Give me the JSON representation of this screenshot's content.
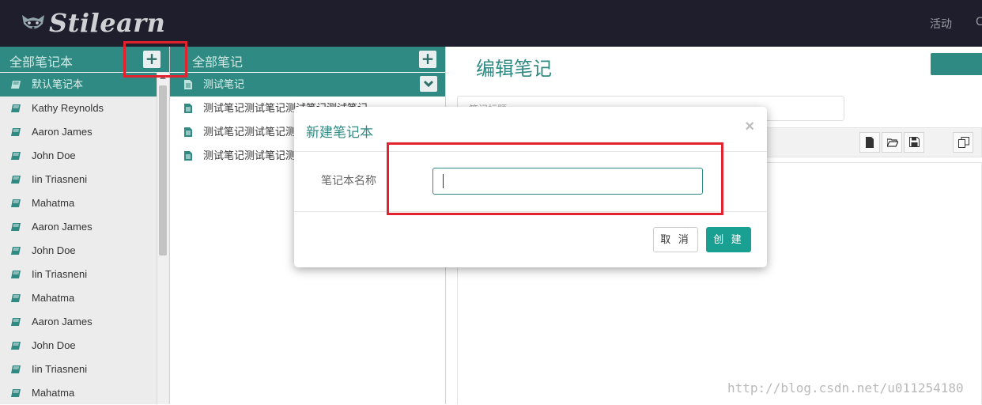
{
  "app": {
    "logo_text": "Stilearn",
    "nav_activity": "活动",
    "nav_edge": "C"
  },
  "notebooks": {
    "header_title": "全部笔记本",
    "add_label": "+",
    "items": [
      {
        "label": "默认笔记本",
        "active": true
      },
      {
        "label": "Kathy Reynolds"
      },
      {
        "label": "Aaron James"
      },
      {
        "label": "John Doe"
      },
      {
        "label": "Iin Triasneni"
      },
      {
        "label": "Mahatma"
      },
      {
        "label": "Aaron James"
      },
      {
        "label": "John Doe"
      },
      {
        "label": "Iin Triasneni"
      },
      {
        "label": "Mahatma"
      },
      {
        "label": "Aaron James"
      },
      {
        "label": "John Doe"
      },
      {
        "label": "Iin Triasneni"
      },
      {
        "label": "Mahatma"
      }
    ]
  },
  "notes": {
    "header_title": "全部笔记",
    "add_label": "+",
    "items": [
      {
        "label": "测试笔记",
        "active": true
      },
      {
        "label": "测试笔记测试笔记测试笔记测试笔记"
      },
      {
        "label": "测试笔记测试笔记测试笔记测试笔记"
      },
      {
        "label": "测试笔记测试笔记测试笔记测试笔记"
      }
    ]
  },
  "editor": {
    "title": "编辑笔记",
    "title_placeholder": "笔记标题"
  },
  "modal": {
    "title": "新建笔记本",
    "close": "×",
    "field_label": "笔记本名称",
    "field_value": "",
    "cancel_label": "取 消",
    "create_label": "创 建"
  },
  "watermark": "http://blog.csdn.net/u011254180",
  "colors": {
    "accent": "#2e8a82",
    "primary_button": "#1aa092",
    "header_bg": "#1f1e2c",
    "annotation_red": "#e32230"
  }
}
